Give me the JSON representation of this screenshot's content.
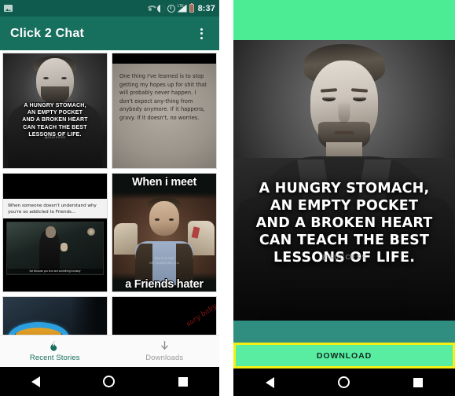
{
  "left_phone": {
    "statusbar": {
      "icons": [
        "image-icon",
        "wifi-icon",
        "sync-icon",
        "alarm-icon",
        "signal-icon",
        "battery-icon"
      ],
      "signal_label": "LTE",
      "time": "8:37"
    },
    "appbar": {
      "title": "Click 2 Chat",
      "overflow_menu": "overflow-menu-icon"
    },
    "grid": {
      "cards": [
        {
          "id": "card-hungry-stomach",
          "type": "quote-photo",
          "quote": "A HUNGRY STOMACH,\nAN EMPTY POCKET\nAND A BROKEN HEART\nCAN TEACH THE BEST\nLESSONS OF LIFE.",
          "signature": "@SUCCESS"
        },
        {
          "id": "card-one-thing-learned",
          "type": "text-note",
          "body": "One thing I've learned is to stop getting my hopes up for shit that will probably never happen.  I don't expect any-thing from anybody anymore. If it happens, gravy.  If it doesn't, no worries."
        },
        {
          "id": "card-friends-addicted",
          "type": "caption-gif",
          "caption": "When someone doesn't understand why\nyou're so addicted to Friends...",
          "subtitle": "but because you love and something humanly"
        },
        {
          "id": "card-friends-hater",
          "type": "meme",
          "top_text": "When i meet",
          "bottom_text": "a Friends hater",
          "mid_text": "that is to sad\nwith people like you"
        },
        {
          "id": "card-blue-ring",
          "type": "photo"
        },
        {
          "id": "card-red-script",
          "type": "photo",
          "script_text": "sary baby"
        }
      ]
    },
    "bottom_nav": [
      {
        "id": "nav-recent-stories",
        "label": "Recent Stories",
        "icon": "flame-icon",
        "active": true
      },
      {
        "id": "nav-downloads",
        "label": "Downloads",
        "icon": "download-arrow-icon",
        "active": false
      }
    ],
    "system_nav": [
      "back-icon",
      "home-icon",
      "recents-icon"
    ]
  },
  "right_phone": {
    "photo": {
      "quote": "A HUNGRY STOMACH,\nAN EMPTY POCKET\nAND A BROKEN HEART\nCAN TEACH THE BEST\nLESSONS OF LIFE.",
      "signature": "@SUCCESS"
    },
    "download_button": {
      "label": "DOWNLOAD"
    },
    "system_nav": [
      "back-icon",
      "home-icon",
      "recents-icon"
    ]
  },
  "colors": {
    "appbar_teal": "#176f5d",
    "statusbar_teal": "#0f5b4e",
    "accent_green": "#4cec95",
    "download_green": "#59eda2",
    "download_border_yellow": "#f5ef12",
    "teal_strip": "#2f8e80",
    "nav_active": "#176f5d",
    "nav_inactive": "#9a9a9a",
    "script_red": "#8c1414"
  }
}
